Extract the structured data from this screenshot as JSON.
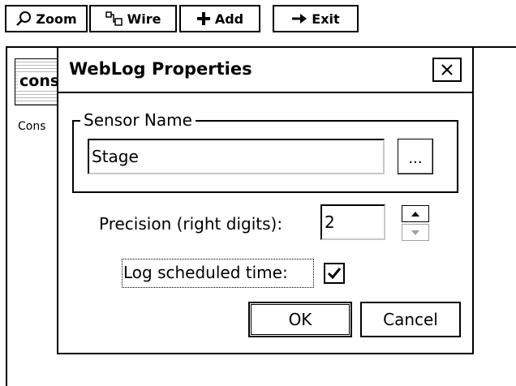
{
  "toolbar": {
    "zoom_label": "Zoom",
    "wire_label": "Wire",
    "add_label": "Add",
    "exit_label": "Exit"
  },
  "canvas": {
    "block_text": "cons",
    "block_label": "Cons"
  },
  "dialog": {
    "title": "WebLog Properties",
    "close_glyph": "✕",
    "sensor_group_label": "Sensor Name",
    "sensor_name_value": "Stage",
    "browse_label": "...",
    "precision_label": "Precision (right digits):",
    "precision_value": "2",
    "log_time_label": "Log scheduled time:",
    "log_time_checked": true,
    "ok_label": "OK",
    "cancel_label": "Cancel"
  },
  "icons": {
    "zoom": "magnifier-icon",
    "wire": "wire-icon",
    "add": "plus-icon",
    "exit": "arrow-right-icon",
    "close": "close-icon",
    "check": "checkmark-icon"
  }
}
